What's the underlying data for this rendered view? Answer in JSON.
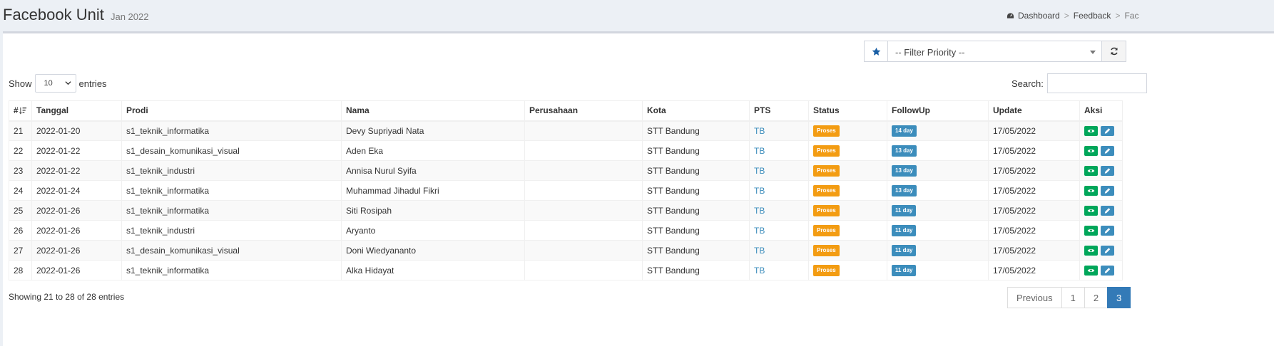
{
  "header": {
    "title": "Facebook Unit",
    "subtitle": "Jan 2022",
    "breadcrumb": {
      "home": "Dashboard",
      "sep": ">",
      "feedback": "Feedback",
      "current": "Fac"
    }
  },
  "filter": {
    "priority_placeholder": "-- Filter Priority --",
    "icons": {
      "addon": "star-icon",
      "refresh": "refresh-icon"
    }
  },
  "length": {
    "show_label": "Show",
    "value": "10",
    "entries_label": "entries"
  },
  "search": {
    "label": "Search:",
    "value": ""
  },
  "table": {
    "columns": [
      "#",
      "Tanggal",
      "Prodi",
      "Nama",
      "Perusahaan",
      "Kota",
      "PTS",
      "Status",
      "FollowUp",
      "Update",
      "Aksi"
    ],
    "rows": [
      {
        "no": "21",
        "tanggal": "2022-01-20",
        "prodi": "s1_teknik_informatika",
        "nama": "Devy Supriyadi Nata",
        "perusahaan": "",
        "kota": "STT Bandung",
        "pts": "TB",
        "status": "Proses",
        "followup": "14 day",
        "update": "17/05/2022"
      },
      {
        "no": "22",
        "tanggal": "2022-01-22",
        "prodi": "s1_desain_komunikasi_visual",
        "nama": "Aden Eka",
        "perusahaan": "",
        "kota": "STT Bandung",
        "pts": "TB",
        "status": "Proses",
        "followup": "13 day",
        "update": "17/05/2022"
      },
      {
        "no": "23",
        "tanggal": "2022-01-22",
        "prodi": "s1_teknik_industri",
        "nama": "Annisa Nurul Syifa",
        "perusahaan": "",
        "kota": "STT Bandung",
        "pts": "TB",
        "status": "Proses",
        "followup": "13 day",
        "update": "17/05/2022"
      },
      {
        "no": "24",
        "tanggal": "2022-01-24",
        "prodi": "s1_teknik_informatika",
        "nama": "Muhammad Jihadul Fikri",
        "perusahaan": "",
        "kota": "STT Bandung",
        "pts": "TB",
        "status": "Proses",
        "followup": "13 day",
        "update": "17/05/2022"
      },
      {
        "no": "25",
        "tanggal": "2022-01-26",
        "prodi": "s1_teknik_informatika",
        "nama": "Siti Rosipah",
        "perusahaan": "",
        "kota": "STT Bandung",
        "pts": "TB",
        "status": "Proses",
        "followup": "11 day",
        "update": "17/05/2022"
      },
      {
        "no": "26",
        "tanggal": "2022-01-26",
        "prodi": "s1_teknik_industri",
        "nama": "Aryanto",
        "perusahaan": "",
        "kota": "STT Bandung",
        "pts": "TB",
        "status": "Proses",
        "followup": "11 day",
        "update": "17/05/2022"
      },
      {
        "no": "27",
        "tanggal": "2022-01-26",
        "prodi": "s1_desain_komunikasi_visual",
        "nama": "Doni Wiedyananto",
        "perusahaan": "",
        "kota": "STT Bandung",
        "pts": "TB",
        "status": "Proses",
        "followup": "11 day",
        "update": "17/05/2022"
      },
      {
        "no": "28",
        "tanggal": "2022-01-26",
        "prodi": "s1_teknik_informatika",
        "nama": "Alka Hidayat",
        "perusahaan": "",
        "kota": "STT Bandung",
        "pts": "TB",
        "status": "Proses",
        "followup": "11 day",
        "update": "17/05/2022"
      }
    ],
    "action_icons": [
      "eye-icon",
      "pencil-icon"
    ]
  },
  "info": "Showing 21 to 28 of 28 entries",
  "pagination": {
    "previous": "Previous",
    "pages": [
      "1",
      "2",
      "3"
    ],
    "active": "3"
  },
  "colors": {
    "status_proses": "#f39c12",
    "followup": "#3c8dbc",
    "view_button": "#00a65a",
    "edit_button": "#3c8dbc",
    "link": "#3c8dbc"
  }
}
